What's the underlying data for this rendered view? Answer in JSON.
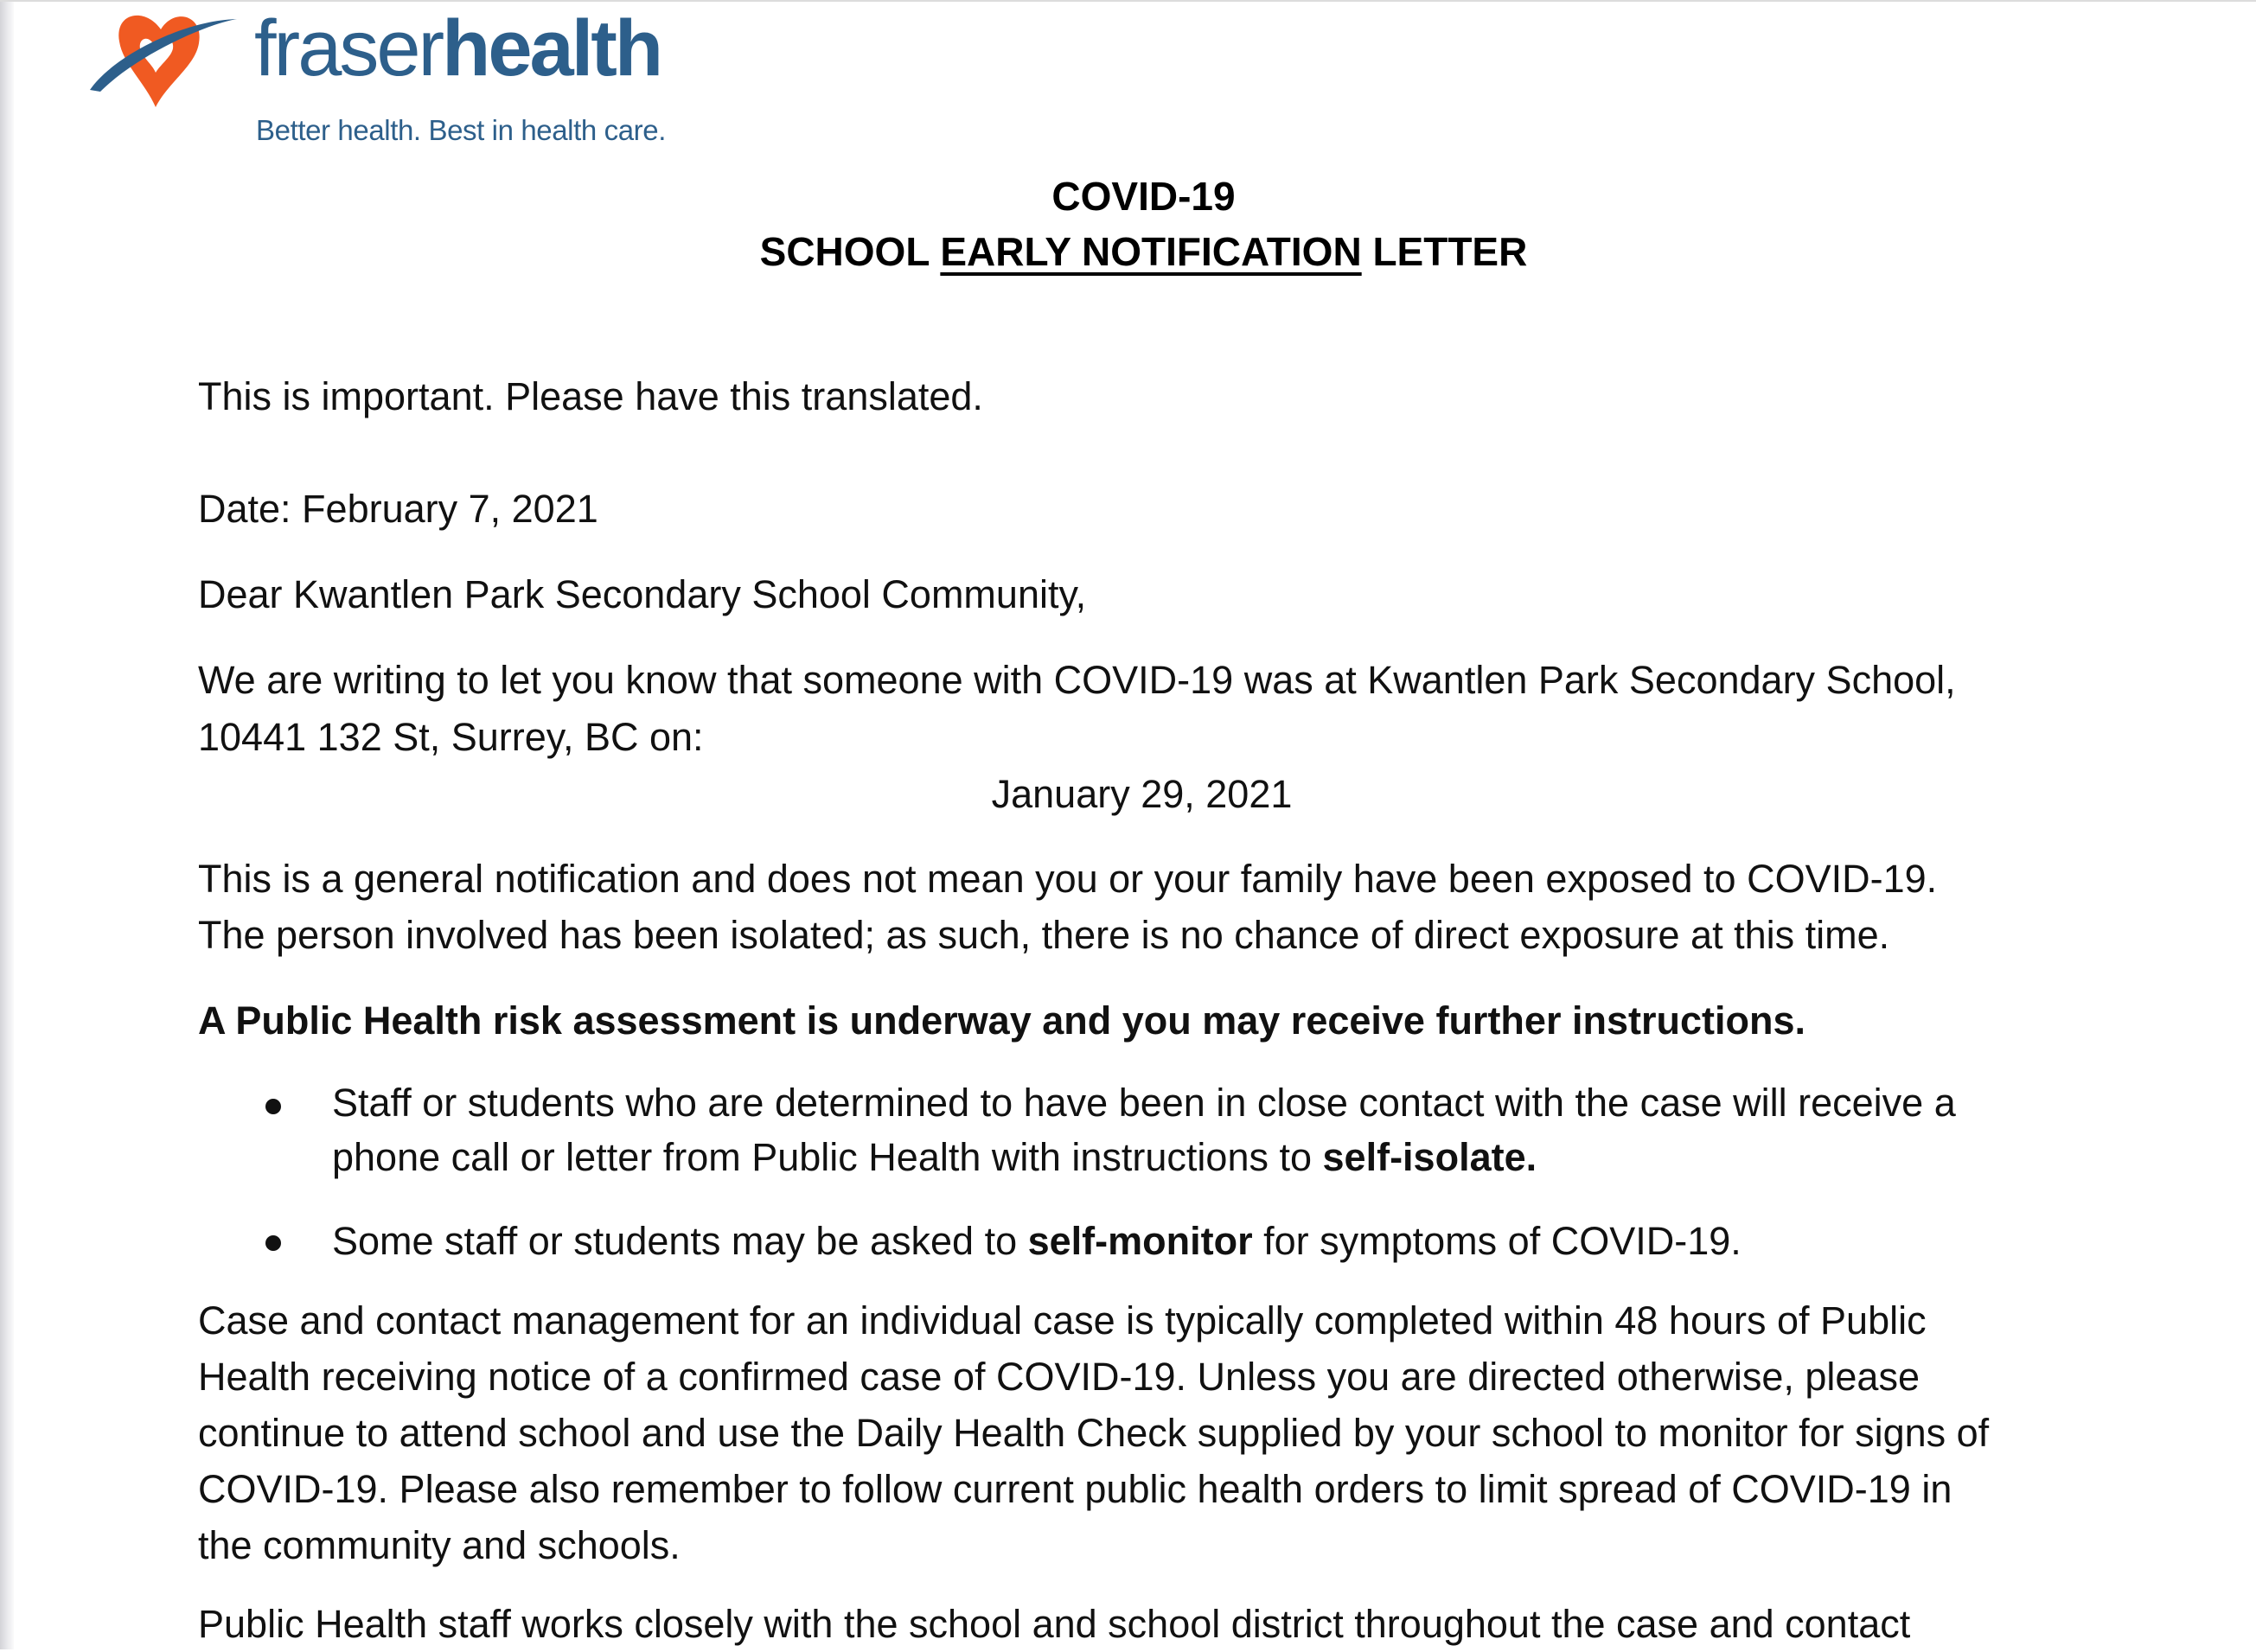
{
  "brand": {
    "name_light": "fraser",
    "name_bold": "health",
    "tagline": "Better health. Best in health care.",
    "colors": {
      "primary": "#2d5f8b",
      "accent": "#f05a22"
    }
  },
  "letter": {
    "title_line1": "COVID-19",
    "title_line2_prefix": "SCHOOL ",
    "title_line2_underlined": "EARLY NOTIFICATION",
    "title_line2_suffix": " LETTER",
    "translate_note": "This is important. Please have this translated.",
    "date_line": "Date: February 7, 2021",
    "salutation": "Dear Kwantlen Park Secondary School  Community,",
    "intro_line1": "We are writing to let you know that someone with COVID-19 was at Kwantlen Park Secondary School,",
    "intro_line2": "10441 132 St, Surrey, BC  on:",
    "exposure_date": "January 29, 2021",
    "general_line1": "This is a general notification and does not mean you or your family have been exposed to COVID-19.",
    "general_line2": "The person involved has been isolated; as such, there is no chance of direct exposure at this time.",
    "assessment_note": "A Public Health risk assessment is underway and you may receive further instructions.",
    "bullets": [
      {
        "line1": "Staff or students who are determined to have been in close contact with the case will receive a",
        "line2_prefix": "phone call or letter from Public Health with instructions to ",
        "line2_bold": "self-isolate."
      },
      {
        "prefix": "Some staff or students may be asked to ",
        "bold": "self-monitor",
        "suffix": " for symptoms of COVID-19."
      }
    ],
    "case_paragraph": [
      "Case and contact management for an individual case is typically completed within 48 hours of Public",
      "Health receiving notice of a confirmed case of COVID-19. Unless you are directed otherwise, please",
      "continue to attend school and use the Daily Health Check supplied by your school to monitor for signs of",
      "COVID-19. Please also remember to follow current public health orders to limit spread of COVID-19 in",
      "the community and schools."
    ],
    "closing_partial": "Public Health staff works closely with the school and school district throughout the case and contact"
  }
}
